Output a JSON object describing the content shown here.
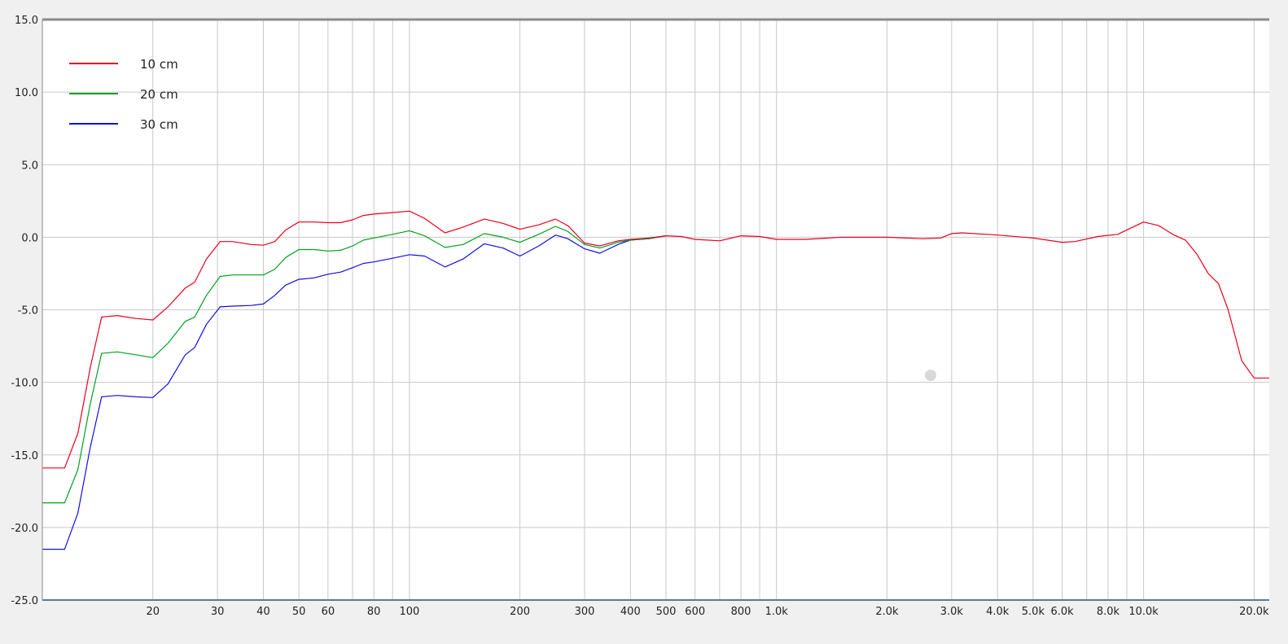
{
  "chart_data": {
    "type": "line",
    "title": "",
    "xlabel": "",
    "ylabel": "",
    "x_scale": "log",
    "xlim": [
      10,
      22000
    ],
    "ylim": [
      -25,
      15
    ],
    "grid": true,
    "legend_position": "top-left",
    "y_ticks": [
      "15.0",
      "10.0",
      "5.0",
      "0.0",
      "-5.0",
      "-10.0",
      "-15.0",
      "-20.0",
      "-25.0"
    ],
    "x_ticks": [
      {
        "value": 20,
        "label": "20"
      },
      {
        "value": 30,
        "label": "30"
      },
      {
        "value": 40,
        "label": "40"
      },
      {
        "value": 50,
        "label": "50"
      },
      {
        "value": 60,
        "label": "60"
      },
      {
        "value": 80,
        "label": "80"
      },
      {
        "value": 100,
        "label": "100"
      },
      {
        "value": 200,
        "label": "200"
      },
      {
        "value": 300,
        "label": "300"
      },
      {
        "value": 400,
        "label": "400"
      },
      {
        "value": 500,
        "label": "500"
      },
      {
        "value": 600,
        "label": "600"
      },
      {
        "value": 800,
        "label": "800"
      },
      {
        "value": 1000,
        "label": "1.0k"
      },
      {
        "value": 2000,
        "label": "2.0k"
      },
      {
        "value": 3000,
        "label": "3.0k"
      },
      {
        "value": 4000,
        "label": "4.0k"
      },
      {
        "value": 5000,
        "label": "5.0k"
      },
      {
        "value": 6000,
        "label": "6.0k"
      },
      {
        "value": 8000,
        "label": "8.0k"
      },
      {
        "value": 10000,
        "label": "10.0k"
      },
      {
        "value": 20000,
        "label": "20.0k"
      }
    ],
    "x_minor_grid": [
      70,
      90,
      700,
      900,
      7000,
      9000
    ],
    "series": [
      {
        "name": "10 cm",
        "color": "#e8001c",
        "points": [
          [
            10,
            -15.9
          ],
          [
            11.5,
            -15.9
          ],
          [
            12.5,
            -13.5
          ],
          [
            13.5,
            -9.0
          ],
          [
            14.5,
            -5.5
          ],
          [
            16,
            -5.4
          ],
          [
            18,
            -5.6
          ],
          [
            20,
            -5.7
          ],
          [
            22,
            -4.8
          ],
          [
            24.5,
            -3.5
          ],
          [
            26,
            -3.1
          ],
          [
            28,
            -1.5
          ],
          [
            30.5,
            -0.3
          ],
          [
            33,
            -0.3
          ],
          [
            37,
            -0.5
          ],
          [
            40,
            -0.55
          ],
          [
            43,
            -0.3
          ],
          [
            46,
            0.5
          ],
          [
            50,
            1.05
          ],
          [
            55,
            1.05
          ],
          [
            60,
            1.0
          ],
          [
            65,
            1.0
          ],
          [
            70,
            1.2
          ],
          [
            75,
            1.5
          ],
          [
            80,
            1.6
          ],
          [
            90,
            1.7
          ],
          [
            100,
            1.8
          ],
          [
            110,
            1.3
          ],
          [
            125,
            0.3
          ],
          [
            140,
            0.7
          ],
          [
            160,
            1.25
          ],
          [
            180,
            0.95
          ],
          [
            200,
            0.55
          ],
          [
            225,
            0.85
          ],
          [
            250,
            1.25
          ],
          [
            270,
            0.8
          ],
          [
            300,
            -0.4
          ],
          [
            330,
            -0.6
          ],
          [
            370,
            -0.25
          ],
          [
            400,
            -0.15
          ],
          [
            450,
            -0.05
          ],
          [
            500,
            0.1
          ],
          [
            550,
            0.05
          ],
          [
            600,
            -0.15
          ],
          [
            700,
            -0.25
          ],
          [
            800,
            0.1
          ],
          [
            900,
            0.05
          ],
          [
            1000,
            -0.15
          ],
          [
            1200,
            -0.15
          ],
          [
            1500,
            0.0
          ],
          [
            2000,
            0.0
          ],
          [
            2500,
            -0.1
          ],
          [
            2800,
            -0.05
          ],
          [
            3000,
            0.25
          ],
          [
            3200,
            0.3
          ],
          [
            4000,
            0.15
          ],
          [
            5000,
            -0.05
          ],
          [
            6000,
            -0.35
          ],
          [
            6500,
            -0.3
          ],
          [
            7500,
            0.05
          ],
          [
            8500,
            0.2
          ],
          [
            10000,
            1.05
          ],
          [
            11000,
            0.8
          ],
          [
            12000,
            0.2
          ],
          [
            13000,
            -0.2
          ],
          [
            14000,
            -1.2
          ],
          [
            15000,
            -2.5
          ],
          [
            16000,
            -3.2
          ],
          [
            17000,
            -5.0
          ],
          [
            18500,
            -8.5
          ],
          [
            20000,
            -9.7
          ],
          [
            22000,
            -9.7
          ]
        ]
      },
      {
        "name": "20 cm",
        "color": "#00a020",
        "points": [
          [
            10,
            -18.3
          ],
          [
            11.5,
            -18.3
          ],
          [
            12.5,
            -16.0
          ],
          [
            13.5,
            -11.5
          ],
          [
            14.5,
            -8.0
          ],
          [
            16,
            -7.9
          ],
          [
            18,
            -8.1
          ],
          [
            20,
            -8.3
          ],
          [
            22,
            -7.3
          ],
          [
            24.5,
            -5.8
          ],
          [
            26,
            -5.5
          ],
          [
            28,
            -4.0
          ],
          [
            30.5,
            -2.7
          ],
          [
            33,
            -2.6
          ],
          [
            37,
            -2.6
          ],
          [
            40,
            -2.6
          ],
          [
            43,
            -2.2
          ],
          [
            46,
            -1.4
          ],
          [
            50,
            -0.85
          ],
          [
            55,
            -0.85
          ],
          [
            60,
            -0.95
          ],
          [
            65,
            -0.9
          ],
          [
            70,
            -0.6
          ],
          [
            75,
            -0.2
          ],
          [
            80,
            -0.05
          ],
          [
            90,
            0.2
          ],
          [
            100,
            0.45
          ],
          [
            110,
            0.1
          ],
          [
            125,
            -0.7
          ],
          [
            140,
            -0.5
          ],
          [
            160,
            0.25
          ],
          [
            180,
            0.0
          ],
          [
            200,
            -0.35
          ],
          [
            225,
            0.2
          ],
          [
            250,
            0.75
          ],
          [
            270,
            0.4
          ],
          [
            300,
            -0.5
          ],
          [
            330,
            -0.75
          ],
          [
            370,
            -0.35
          ],
          [
            400,
            -0.2
          ],
          [
            450,
            -0.1
          ],
          [
            500,
            0.1
          ]
        ]
      },
      {
        "name": "30 cm",
        "color": "#1010e0",
        "points": [
          [
            10,
            -21.5
          ],
          [
            11.5,
            -21.5
          ],
          [
            12.5,
            -19.0
          ],
          [
            13.5,
            -14.5
          ],
          [
            14.5,
            -11.0
          ],
          [
            16,
            -10.9
          ],
          [
            18,
            -11.0
          ],
          [
            20,
            -11.05
          ],
          [
            22,
            -10.1
          ],
          [
            24.5,
            -8.1
          ],
          [
            26,
            -7.6
          ],
          [
            28,
            -6.0
          ],
          [
            30.5,
            -4.8
          ],
          [
            33,
            -4.75
          ],
          [
            37,
            -4.7
          ],
          [
            40,
            -4.6
          ],
          [
            43,
            -4.0
          ],
          [
            46,
            -3.3
          ],
          [
            50,
            -2.9
          ],
          [
            55,
            -2.8
          ],
          [
            60,
            -2.55
          ],
          [
            65,
            -2.4
          ],
          [
            70,
            -2.1
          ],
          [
            75,
            -1.8
          ],
          [
            80,
            -1.7
          ],
          [
            90,
            -1.45
          ],
          [
            100,
            -1.2
          ],
          [
            110,
            -1.3
          ],
          [
            125,
            -2.05
          ],
          [
            140,
            -1.5
          ],
          [
            160,
            -0.45
          ],
          [
            180,
            -0.75
          ],
          [
            200,
            -1.3
          ],
          [
            225,
            -0.6
          ],
          [
            250,
            0.15
          ],
          [
            270,
            -0.1
          ],
          [
            300,
            -0.8
          ],
          [
            330,
            -1.1
          ],
          [
            370,
            -0.5
          ],
          [
            400,
            -0.2
          ],
          [
            450,
            -0.1
          ],
          [
            500,
            0.1
          ]
        ]
      }
    ]
  }
}
